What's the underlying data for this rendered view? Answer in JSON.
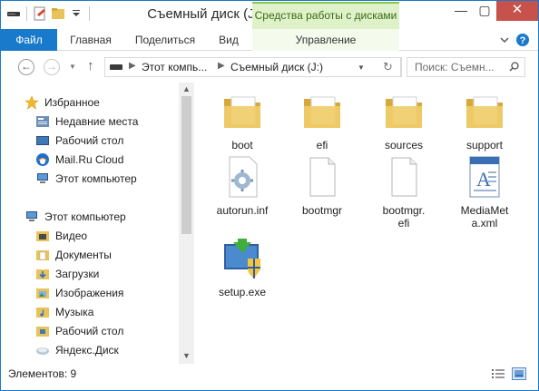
{
  "window": {
    "title": "Съемный диск (J:)",
    "context_tab_group": "Средства работы с дисками",
    "minimize": "—",
    "maximize": "▢",
    "close": "✕"
  },
  "ribbon": {
    "tabs": {
      "file": "Файл",
      "home": "Главная",
      "share": "Поделиться",
      "view": "Вид",
      "manage": "Управление"
    }
  },
  "address": {
    "crumbs": [
      "Этот компь...",
      "Съемный диск (J:)"
    ],
    "search_placeholder": "Поиск: Съемн..."
  },
  "navigation": {
    "favorites_header": "Избранное",
    "favorites": [
      "Недавние места",
      "Рабочий стол",
      "Mail.Ru Cloud",
      "Этот компьютер"
    ],
    "computer_header": "Этот компьютер",
    "computer_items": [
      "Видео",
      "Документы",
      "Загрузки",
      "Изображения",
      "Музыка",
      "Рабочий стол",
      "Яндекс.Диск"
    ]
  },
  "files": [
    {
      "name": "boot",
      "icon": "folder-icon"
    },
    {
      "name": "efi",
      "icon": "folder-icon"
    },
    {
      "name": "sources",
      "icon": "folder-icon"
    },
    {
      "name": "support",
      "icon": "folder-icon"
    },
    {
      "name": "autorun.inf",
      "icon": "settings-file-icon"
    },
    {
      "name": "bootmgr",
      "icon": "blank-file-icon"
    },
    {
      "name": "bootmgr.efi",
      "icon": "blank-file-icon"
    },
    {
      "name": "MediaMeta.xml",
      "icon": "xml-file-icon"
    },
    {
      "name": "setup.exe",
      "icon": "setup-icon"
    }
  ],
  "status": {
    "items_count": "Элементов: 9"
  },
  "colors": {
    "accent": "#1979ca",
    "context_tab": "#dff1c9",
    "folder": "#e8c35a",
    "close_button": "#c7514b"
  }
}
